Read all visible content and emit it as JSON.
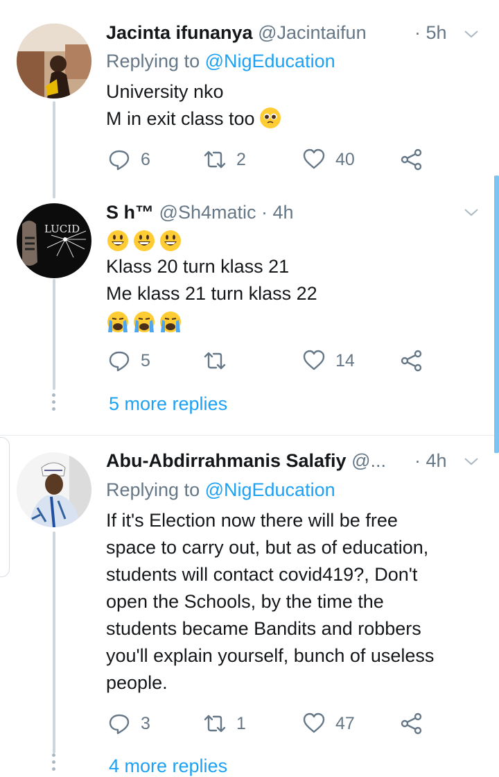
{
  "tweets": [
    {
      "name": "Jacinta ifunanya",
      "handle": "@Jacintaifun...",
      "time": "· 5h",
      "replying_prefix": "Replying to ",
      "replying_to": "@NigEducation",
      "lines": [
        "University nko",
        "M in exit class too"
      ],
      "line2_emoji": "pleading-face",
      "replies": "6",
      "retweets": "2",
      "likes": "40"
    },
    {
      "name": "S h™",
      "handle": "@Sh4matic · 4h",
      "lines": [
        "Klass 20 turn klass 21",
        "Me klass 21 turn klass 22"
      ],
      "emoji_top": "grinning-face ×3",
      "emoji_bottom": "crying-face ×3",
      "avatar_text": "LUCID",
      "replies": "5",
      "retweets": "",
      "likes": "14",
      "more_replies": "5 more replies"
    },
    {
      "name": "Abu-Abdirrahmanis Salafiy",
      "handle": "@...",
      "time": "· 4h",
      "replying_prefix": "Replying to ",
      "replying_to": "@NigEducation",
      "lines": [
        "If it's Election now there will be free",
        "space to carry out, but as of education,",
        "students will contact covid419?, Don't",
        "open the Schools, by the time the",
        "students became Bandits and robbers",
        "you'll explain yourself, bunch of useless",
        "people."
      ],
      "replies": "3",
      "retweets": "1",
      "likes": "47",
      "more_replies": "4 more replies"
    }
  ],
  "colors": {
    "accent": "#1da1f2",
    "secondary_text": "#657786",
    "primary_text": "#14171a"
  }
}
